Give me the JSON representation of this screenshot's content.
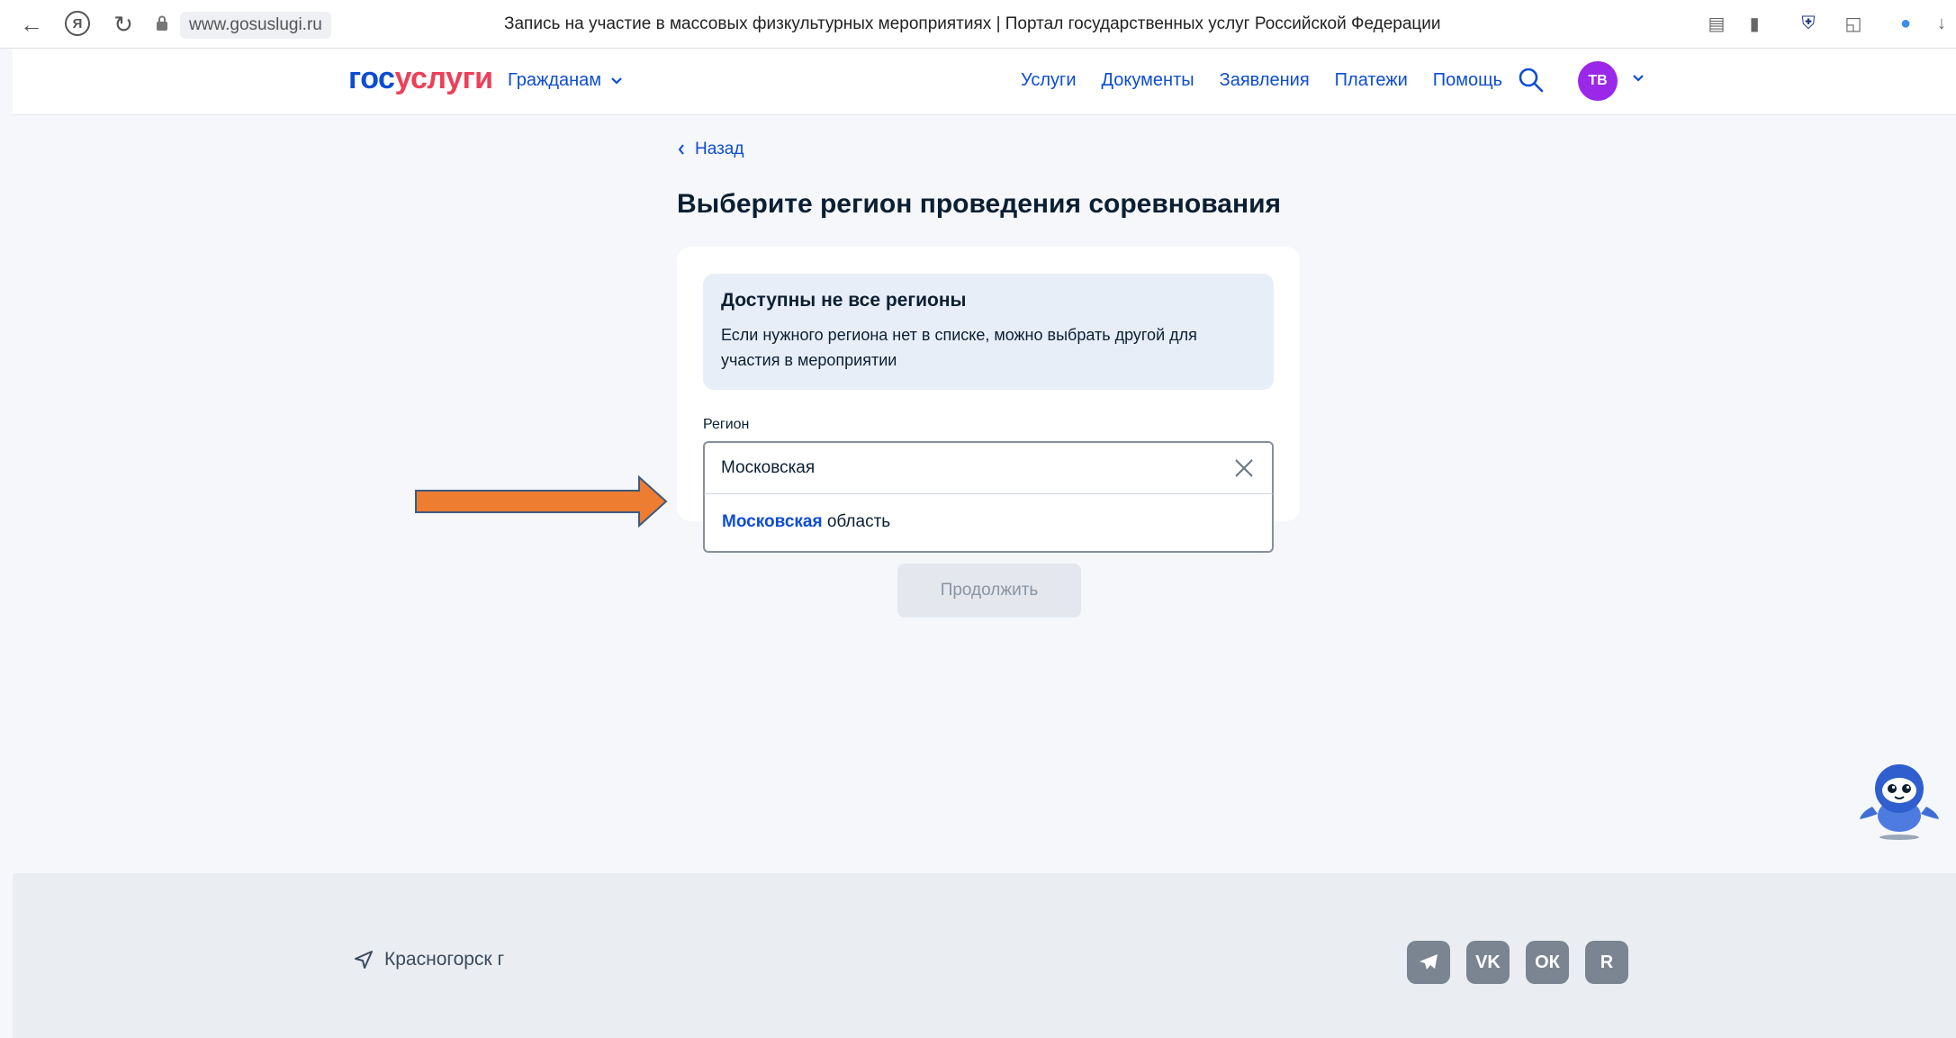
{
  "browser": {
    "url": "www.gosuslugi.ru",
    "tab_title": "Запись на участие в массовых физкультурных мероприятиях | Портал государственных услуг Российской Федерации",
    "ya_label": "Я"
  },
  "header": {
    "logo_part1": "гос",
    "logo_part2": "услуги",
    "citizens_label": "Гражданам",
    "nav": [
      "Услуги",
      "Документы",
      "Заявления",
      "Платежи",
      "Помощь"
    ],
    "avatar_initials": "ТВ"
  },
  "main": {
    "back_label": "Назад",
    "title": "Выберите регион проведения соревнования",
    "info": {
      "title": "Доступны не все регионы",
      "text": "Если нужного региона нет в списке, можно выбрать другой для участия в мероприятии"
    },
    "region": {
      "label": "Регион",
      "value": "Московская",
      "suggestion_match": "Московская",
      "suggestion_rest": " область"
    },
    "continue_label": "Продолжить"
  },
  "footer": {
    "location": "Красногорск г",
    "social": [
      "telegram-icon",
      "vk-icon",
      "ok-icon",
      "rutube-icon"
    ],
    "vk_label": "VK",
    "ok_label": "ОК",
    "rt_label": "R"
  },
  "colors": {
    "brand_blue": "#0d4cd3",
    "brand_red": "#ee3f58",
    "avatar": "#9b27e8",
    "arrow": "#ed7d31"
  }
}
